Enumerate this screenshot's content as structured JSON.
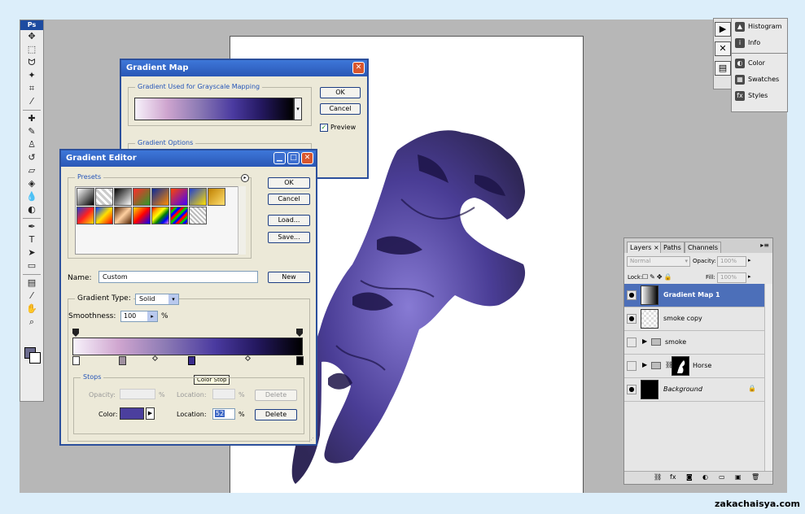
{
  "colors": {
    "workspace": "#b7b7b7",
    "dialog_face": "#ece9d8",
    "title_active": "#2a57b5",
    "selected_layer": "#4c6fb9",
    "horse_dark": "#1d1448",
    "horse_mid": "#3a2c8c",
    "horse_light": "#7d6fd0",
    "stop_color": "#4b3f9e"
  },
  "watermark": "zakachaisya.com",
  "toolbox": {
    "app_badge": "Ps",
    "tools": [
      {
        "icon": "move-icon",
        "glyph": "✥"
      },
      {
        "icon": "marquee-icon",
        "glyph": "⬚"
      },
      {
        "icon": "lasso-icon",
        "glyph": "ᗢ"
      },
      {
        "icon": "magic-wand-icon",
        "glyph": "✦"
      },
      {
        "icon": "crop-icon",
        "glyph": "⌗"
      },
      {
        "icon": "slice-icon",
        "glyph": "⁄"
      },
      {
        "icon": "healing-brush-icon",
        "glyph": "✚"
      },
      {
        "icon": "brush-icon",
        "glyph": "✎"
      },
      {
        "icon": "clone-stamp-icon",
        "glyph": "♙"
      },
      {
        "icon": "history-brush-icon",
        "glyph": "↺"
      },
      {
        "icon": "eraser-icon",
        "glyph": "▱"
      },
      {
        "icon": "paint-bucket-icon",
        "glyph": "◈"
      },
      {
        "icon": "blur-icon",
        "glyph": "💧"
      },
      {
        "icon": "dodge-icon",
        "glyph": "◐"
      },
      {
        "icon": "pen-icon",
        "glyph": "✒"
      },
      {
        "icon": "type-icon",
        "glyph": "T"
      },
      {
        "icon": "path-select-icon",
        "glyph": "➤"
      },
      {
        "icon": "shape-icon",
        "glyph": "▭"
      },
      {
        "icon": "notes-icon",
        "glyph": "▤"
      },
      {
        "icon": "eyedropper-icon",
        "glyph": "⁄"
      },
      {
        "icon": "hand-icon",
        "glyph": "✋"
      },
      {
        "icon": "zoom-icon",
        "glyph": "⌕"
      }
    ]
  },
  "palette_icons": [
    {
      "icon": "actions-icon",
      "glyph": "▶"
    },
    {
      "icon": "tool-presets-icon",
      "glyph": "✕"
    },
    {
      "icon": "layer-comps-icon",
      "glyph": "▤"
    }
  ],
  "palette_menu": [
    {
      "label": "Histogram",
      "icon": "histogram-icon",
      "glyph": "▲"
    },
    {
      "label": "Info",
      "icon": "info-icon",
      "glyph": "i"
    },
    {
      "label": "Color",
      "icon": "color-icon",
      "glyph": "◐"
    },
    {
      "label": "Swatches",
      "icon": "swatches-icon",
      "glyph": "▦"
    },
    {
      "label": "Styles",
      "icon": "styles-icon",
      "glyph": "fx"
    }
  ],
  "gradient_map": {
    "title": "Gradient Map",
    "group_label": "Gradient Used for Grayscale Mapping",
    "ok": "OK",
    "cancel": "Cancel",
    "preview_label": "Preview",
    "options_label": "Gradient Options"
  },
  "gradient_editor": {
    "title": "Gradient Editor",
    "presets_label": "Presets",
    "ok": "OK",
    "cancel": "Cancel",
    "load": "Load...",
    "save": "Save...",
    "name_label": "Name:",
    "name_value": "Custom",
    "new": "New",
    "gradient_type_label": "Gradient Type:",
    "gradient_type_value": "Solid",
    "smoothness_label": "Smoothness:",
    "smoothness_value": "100",
    "percent": "%",
    "tooltip": "Color Stop",
    "stops": {
      "label": "Stops",
      "opacity_label": "Opacity:",
      "location_label": "Location:",
      "delete": "Delete",
      "color_label": "Color:",
      "location_value": "52"
    },
    "presets": [
      "linear-gradient(135deg,#fff,#000)",
      "repeating-linear-gradient(45deg,#ccc 0 3px,#fff 3px 6px)",
      "linear-gradient(135deg,#000,#fff)",
      "linear-gradient(135deg,#ff2b2b,#2b9a2b)",
      "linear-gradient(135deg,#0a2a9a,#ff8a00)",
      "linear-gradient(135deg,#ff4400,#4400ff)",
      "linear-gradient(135deg,#2040d0,#ffe000)",
      "linear-gradient(135deg,#c08000,#ffe070)",
      "linear-gradient(135deg,#2040d0,#ff2020,#ffe000)",
      "linear-gradient(135deg,#0040ff,#ffe000,#ff0000)",
      "linear-gradient(135deg,#502000,#ffd0a0,#502000)",
      "linear-gradient(135deg,#ffe000,#ff0000,#0000ff)",
      "linear-gradient(135deg,red,orange,yellow,green,blue,violet)",
      "repeating-linear-gradient(135deg,#ff0000 0 3px,#00c000 3px 6px,#0000ff 6px 9px)",
      "repeating-linear-gradient(45deg,#bbb 0 2px,#fff 2px 4px)"
    ]
  },
  "layers": {
    "tabs": [
      "Layers",
      "Paths",
      "Channels"
    ],
    "blend_mode": "Normal",
    "opacity_label": "Opacity:",
    "opacity_value": "100%",
    "lock_label": "Lock:",
    "fill_label": "Fill:",
    "fill_value": "100%",
    "rows": [
      {
        "name": "Gradient Map 1",
        "visible": true,
        "selected": true,
        "type": "adjustment"
      },
      {
        "name": "smoke copy",
        "visible": true,
        "selected": false,
        "type": "layer"
      },
      {
        "name": "smoke",
        "visible": false,
        "selected": false,
        "type": "group"
      },
      {
        "name": "Horse",
        "visible": false,
        "selected": false,
        "type": "group-mask"
      },
      {
        "name": "Background",
        "visible": true,
        "selected": false,
        "type": "background"
      }
    ],
    "footer_icons": [
      "link-icon",
      "fx-icon",
      "mask-icon",
      "adjustment-icon",
      "folder-icon",
      "new-layer-icon",
      "trash-icon"
    ]
  }
}
